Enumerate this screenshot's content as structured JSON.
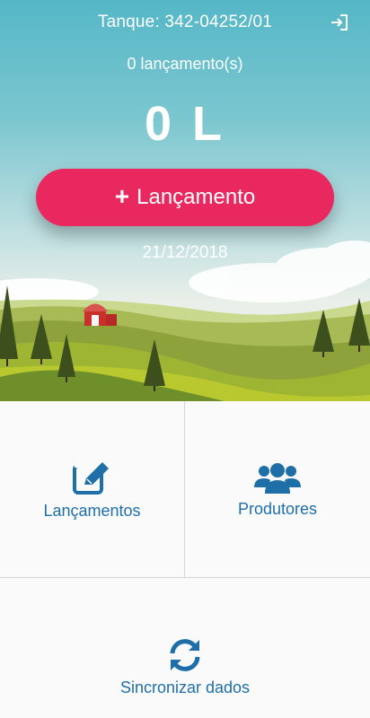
{
  "header": {
    "tank_label": "Tanque: 342-04252/01",
    "logout_icon": "sign-out-icon"
  },
  "summary": {
    "launch_count_text": "0 lançamento(s)",
    "volume_text": "0 L",
    "date_text": "21/12/2018"
  },
  "actions": {
    "add_launch_label": "Lançamento",
    "add_launch_icon": "plus"
  },
  "menu": {
    "launches_label": "Lançamentos",
    "launches_icon": "edit-icon",
    "producers_label": "Produtores",
    "producers_icon": "users-icon",
    "sync_label": "Sincronizar dados",
    "sync_icon": "sync-icon"
  },
  "colors": {
    "accent": "#e8285e",
    "link_blue": "#1e6fa8",
    "sky_top": "#55b7c7"
  }
}
